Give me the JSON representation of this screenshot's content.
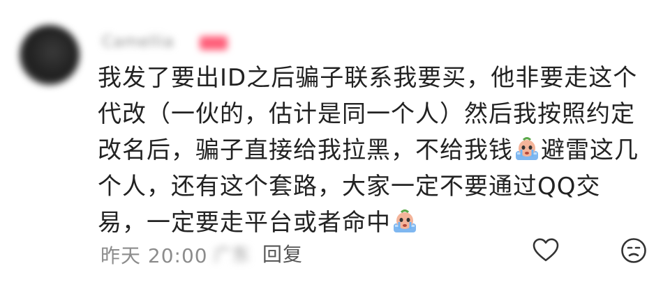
{
  "comment": {
    "username": "Camellia",
    "badge_text": "作者",
    "body_segments": {
      "part1": "我发了要出ID之后骗子联系我要买，他非要走这个代改（一伙的，估计是同一个人）然后我按照约定改名后，骗子直接给我拉黑，不给我钱",
      "part2": "避雷这几个人，还有这个套路，大家一定不要通过QQ交易，一定要走平台或者命中"
    },
    "emoji_name": "crying-face-emoji",
    "timestamp": "昨天 20:00",
    "location": "广东",
    "reply_label": "回复",
    "like_icon": "heart-outline-icon",
    "dislike_icon": "sad-face-icon",
    "colors": {
      "text": "#222222",
      "meta": "#8c8c8c",
      "icon": "#333333"
    }
  }
}
